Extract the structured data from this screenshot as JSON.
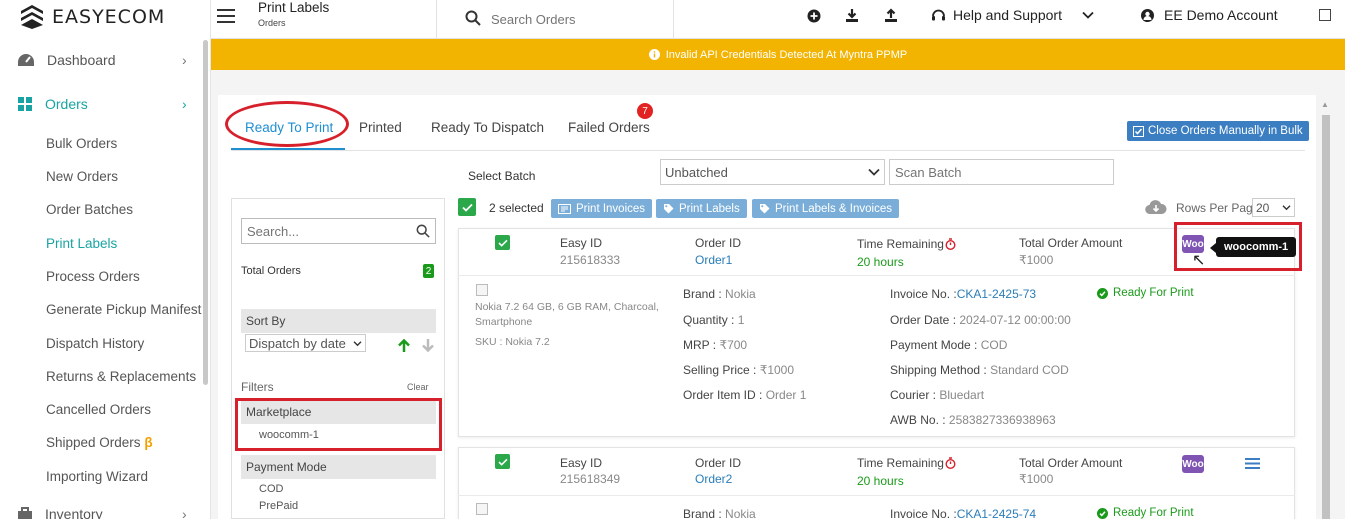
{
  "app": {
    "brand": "EASYECOM"
  },
  "header": {
    "page_title": "Print Labels",
    "page_subtitle": "Orders",
    "search_placeholder": "Search Orders",
    "help_label": "Help and Support",
    "account_label": "EE Demo Account"
  },
  "banner": {
    "text": "Invalid API Credentials Detected At Myntra PPMP"
  },
  "sidebar": {
    "dashboard": "Dashboard",
    "orders": "Orders",
    "items": [
      "Bulk Orders",
      "New Orders",
      "Order Batches",
      "Print Labels",
      "Process Orders",
      "Generate Pickup Manifest",
      "Dispatch History",
      "Returns & Replacements",
      "Cancelled Orders",
      "Shipped Orders",
      "Importing Wizard"
    ],
    "beta": "β",
    "inventory": "Inventory"
  },
  "tabs": {
    "ready_to_print": "Ready To Print",
    "printed": "Printed",
    "ready_to_dispatch": "Ready To Dispatch",
    "failed_orders": "Failed Orders",
    "failed_count": "7"
  },
  "actions": {
    "close_bulk": "Close Orders Manually in Bulk",
    "select_batch": "Select Batch",
    "batch_value": "Unbatched",
    "scan_placeholder": "Scan Batch",
    "selected": "2 selected",
    "print_invoices": "Print Invoices",
    "print_labels": "Print Labels",
    "print_labels_invoices": "Print Labels & Invoices",
    "rows_per_page": "Rows Per Page",
    "rows_value": "20"
  },
  "filters": {
    "search_placeholder": "Search...",
    "total_orders_label": "Total Orders",
    "total_orders": "2",
    "sort_by": "Sort By",
    "sort_value": "Dispatch by date",
    "filters": "Filters",
    "clear": "Clear",
    "marketplace": "Marketplace",
    "marketplace_value": "woocomm-1",
    "payment_mode": "Payment Mode",
    "payment_options": [
      "COD",
      "PrePaid"
    ]
  },
  "labels": {
    "easy_id": "Easy ID",
    "order_id": "Order ID",
    "time_remaining": "Time Remaining",
    "total_amount": "Total Order Amount",
    "brand": "Brand : ",
    "quantity": "Quantity : ",
    "mrp": "MRP : ",
    "selling_price": "Selling Price : ",
    "order_item_id": "Order Item ID : ",
    "invoice_no": "Invoice No. :",
    "order_date": "Order Date : ",
    "payment_mode": "Payment Mode : ",
    "shipping_method": "Shipping Method : ",
    "courier": "Courier : ",
    "awb": "AWB No. : ",
    "sku": "SKU : ",
    "woo": "Woo",
    "tooltip": "woocomm-1"
  },
  "orders": [
    {
      "easy_id": "215618333",
      "order_id": "Order1",
      "time": "20 hours",
      "amount": "₹1000",
      "product": "Nokia 7.2 64 GB, 6 GB RAM, Charcoal, Smartphone",
      "sku": "Nokia 7.2",
      "brand": "Nokia",
      "quantity": "1",
      "mrp": "₹700",
      "selling_price": "₹1000",
      "order_item_id": "Order 1",
      "invoice": "CKA1-2425-73",
      "order_date": "2024-07-12 00:00:00",
      "payment_mode": "COD",
      "shipping_method": "Standard COD",
      "courier": "Bluedart",
      "awb": "2583827336938963",
      "status": "Ready For Print"
    },
    {
      "easy_id": "215618349",
      "order_id": "Order2",
      "time": "20 hours",
      "amount": "₹1000",
      "brand": "Nokia",
      "invoice": "CKA1-2425-74",
      "status": "Ready For Print"
    }
  ],
  "colors": {
    "accent": "#1aa3a3",
    "banner": "#f2b400",
    "primary": "#3b7ec1",
    "highlight": "#d6202b",
    "success": "#1a9a1a",
    "woo": "#7f54b3"
  }
}
